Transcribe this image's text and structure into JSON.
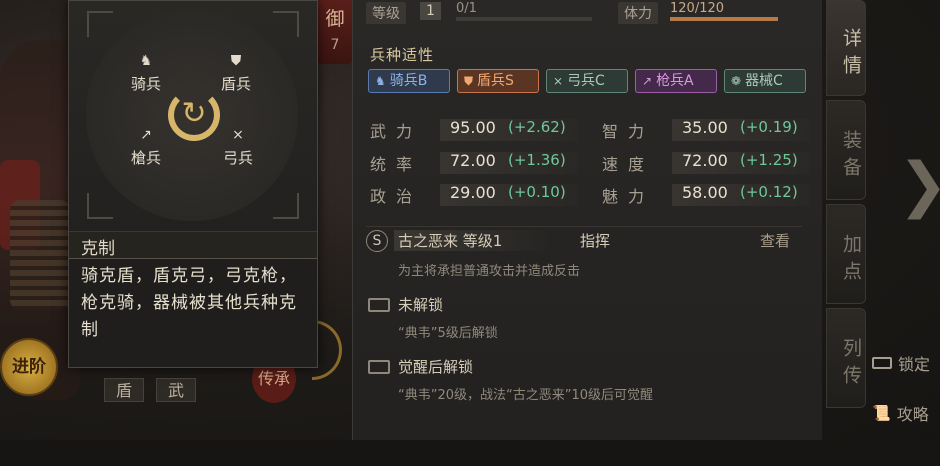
{
  "top": {
    "level_label": "等级",
    "level_value": "1",
    "exp_text": "0/1",
    "exp_progress": 0,
    "stamina_label": "体力",
    "stamina_text": "120/120",
    "stamina_progress": 1.0
  },
  "defense_badge": {
    "label": "御",
    "value": "7"
  },
  "unit_affinity": {
    "title": "兵种适性",
    "tags": [
      {
        "icon": "cavalry-icon",
        "label": "骑兵B",
        "color": "#8fb3e6",
        "bg": "#2f3a4d",
        "border": "#5b7bb0"
      },
      {
        "icon": "shield-icon",
        "label": "盾兵S",
        "color": "#f0a870",
        "bg": "#5a3524",
        "border": "#c9744a"
      },
      {
        "icon": "bow-icon",
        "label": "弓兵C",
        "color": "#a8c9b8",
        "bg": "#2e3a35",
        "border": "#5f8878"
      },
      {
        "icon": "spear-icon",
        "label": "枪兵A",
        "color": "#d79ae0",
        "bg": "#44294a",
        "border": "#9a5fa6"
      },
      {
        "icon": "siege-icon",
        "label": "器械C",
        "color": "#a8c9b8",
        "bg": "#2e3a35",
        "border": "#5f8878"
      }
    ]
  },
  "stats": {
    "left": [
      {
        "label": "武力",
        "value": "95.00",
        "bonus": "(+2.62)"
      },
      {
        "label": "统率",
        "value": "72.00",
        "bonus": "(+1.36)"
      },
      {
        "label": "政治",
        "value": "29.00",
        "bonus": "(+0.10)"
      }
    ],
    "right": [
      {
        "label": "智力",
        "value": "35.00",
        "bonus": "(+0.19)"
      },
      {
        "label": "速度",
        "value": "72.00",
        "bonus": "(+1.25)"
      },
      {
        "label": "魅力",
        "value": "58.00",
        "bonus": "(+0.12)"
      }
    ]
  },
  "skills": {
    "skill1": {
      "badge": "S",
      "name": "古之恶来 等级1",
      "type": "指挥",
      "view": "查看",
      "desc": "为主将承担普通攻击并造成反击"
    },
    "skill2": {
      "title": "未解锁",
      "desc": "“典韦”5级后解锁"
    },
    "skill3": {
      "title": "觉醒后解锁",
      "desc": "“典韦”20级，战法“古之恶来”10级后可觉醒"
    }
  },
  "side_tabs": [
    "详情",
    "装备",
    "加点",
    "列传"
  ],
  "right_buttons": {
    "lock": "锁定",
    "guide": "攻略"
  },
  "popup": {
    "units": {
      "cavalry": "骑兵",
      "shield": "盾兵",
      "spear": "槍兵",
      "bow": "弓兵"
    },
    "heading": "克制",
    "text": "骑克盾，盾克弓，弓克枪，枪克骑，器械被其他兵种克制"
  },
  "bottom": {
    "advance": "进阶",
    "tab1": "盾",
    "tab2": "武",
    "inherit": "传承"
  }
}
